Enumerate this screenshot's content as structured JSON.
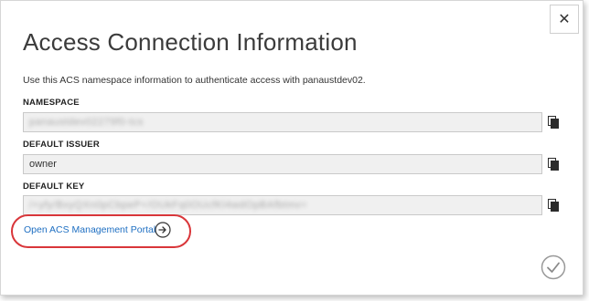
{
  "dialog": {
    "title": "Access Connection Information",
    "intro": "Use this ACS namespace information to authenticate access with panaustdev02.",
    "close_icon": "close-icon",
    "fields": [
      {
        "label": "NAMESPACE",
        "value": "panaustdev02279f0-tcs",
        "redacted": true
      },
      {
        "label": "DEFAULT ISSUER",
        "value": "owner",
        "redacted": false
      },
      {
        "label": "DEFAULT KEY",
        "value": "/+yfy/BxyQXn0pCbpeP+/OUkFq0OUcfKl4wdOpBAfbtmv=",
        "redacted": true
      }
    ],
    "copy_icon": "copy-icon",
    "portal_link": "Open ACS Management Portal",
    "portal_icon": "arrow-circle-icon",
    "ok_icon": "checkmark-icon"
  },
  "colors": {
    "link": "#1e6fc2",
    "annotation": "#d9363a",
    "field_bg": "#f0f0f0"
  }
}
